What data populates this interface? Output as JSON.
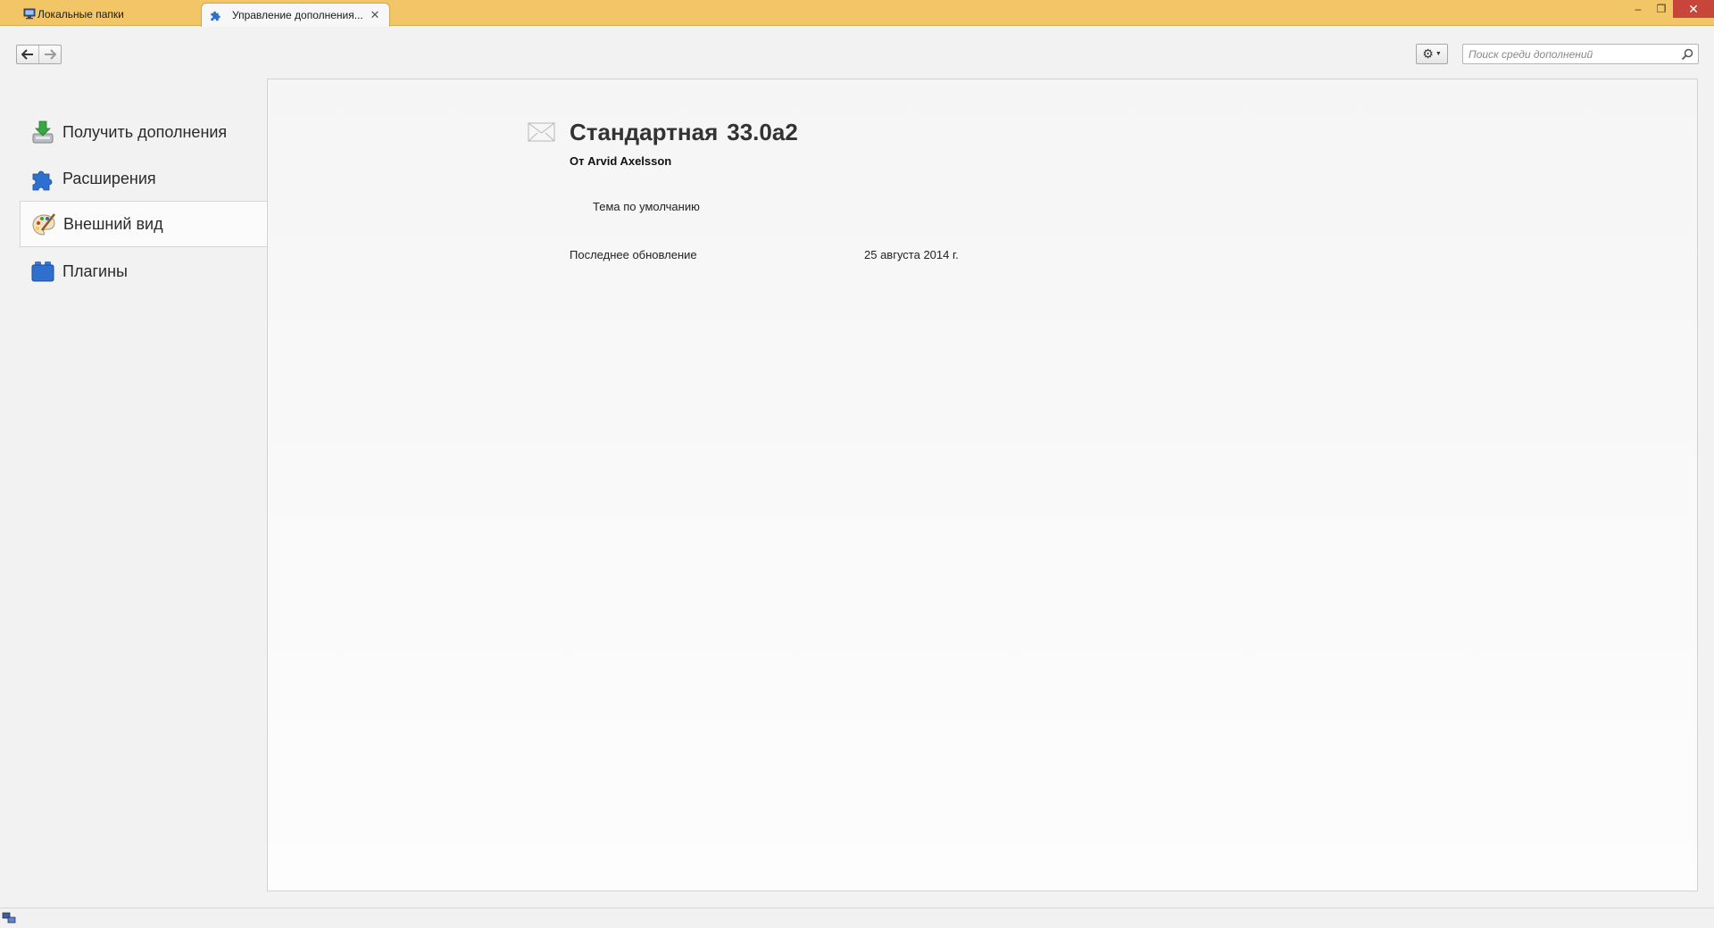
{
  "tabs": [
    {
      "label": "Локальные папки",
      "active": false,
      "icon": "local-folders-icon"
    },
    {
      "label": "Управление дополнения...",
      "active": true,
      "icon": "puzzle-icon",
      "close_glyph": "✕"
    }
  ],
  "window_controls": {
    "minimize": "–",
    "restore": "❐",
    "close": "✕"
  },
  "toolbar": {
    "back_glyph": "🡐",
    "forward_glyph": "🡒",
    "gear_glyph": "⚙",
    "gear_caret": "▼",
    "search_placeholder": "Поиск среди дополнений"
  },
  "sidebar": {
    "items": [
      {
        "label": "Получить дополнения",
        "icon": "download-addons-icon",
        "selected": false
      },
      {
        "label": "Расширения",
        "icon": "puzzle-extensions-icon",
        "selected": false
      },
      {
        "label": "Внешний вид",
        "icon": "palette-appearance-icon",
        "selected": true
      },
      {
        "label": "Плагины",
        "icon": "lego-plugins-icon",
        "selected": false
      }
    ]
  },
  "addon": {
    "name": "Стандартная",
    "version": "33.0a2",
    "author": "От Arvid Axelsson",
    "description": "Тема по умолчанию",
    "details": [
      {
        "label": "Последнее обновление",
        "value": "25 августа 2014 г."
      }
    ]
  },
  "colors": {
    "tabbar": "#f2c666",
    "window_close": "#c7453a",
    "accent_blue": "#2f6fce",
    "accent_green": "#3aa744"
  }
}
